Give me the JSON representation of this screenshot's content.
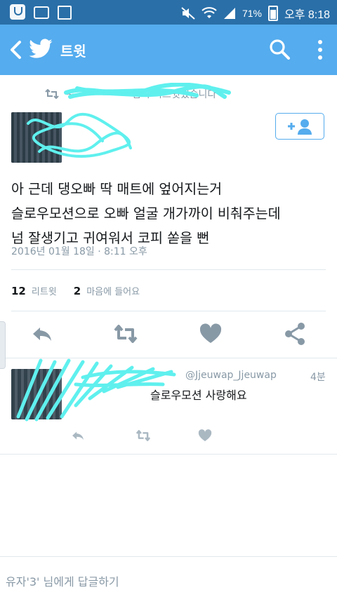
{
  "status_bar": {
    "battery": "71%",
    "time": "오후 8:18"
  },
  "header": {
    "title": "트윗"
  },
  "tweet": {
    "retweet_context": "~~~~~~~~님이 리트윗했습니다",
    "text_lines": [
      "아 근데 댕오빠 딱 매트에 엎어지는거",
      "슬로우모션으로 오빠 얼굴 개가까이 비춰주는데",
      "넘 잘생기고 귀여워서 코피 쏟을 뻔"
    ],
    "timestamp": "2016년 01월 18일 · 8:11 오후",
    "retweets_count": "12",
    "retweets_label": "리트윗",
    "likes_count": "2",
    "likes_label": "마음에 들어요"
  },
  "reply": {
    "handle": "@Jjeuwap_Jjeuwap",
    "time": "4분",
    "text": "슬로우모션 사랑해요"
  },
  "compose": {
    "placeholder": "유자'3' 님에게 답글하기"
  },
  "colors": {
    "status_bar": "#2a6fa8",
    "app_bar": "#55acee",
    "scribble": "#5ff0ee",
    "icon_gray": "#8899a6"
  },
  "icons": [
    "back-icon",
    "twitter-bird-icon",
    "search-icon",
    "more-icon",
    "retweet-icon",
    "reply-icon",
    "heart-icon",
    "share-icon",
    "add-user-icon"
  ]
}
